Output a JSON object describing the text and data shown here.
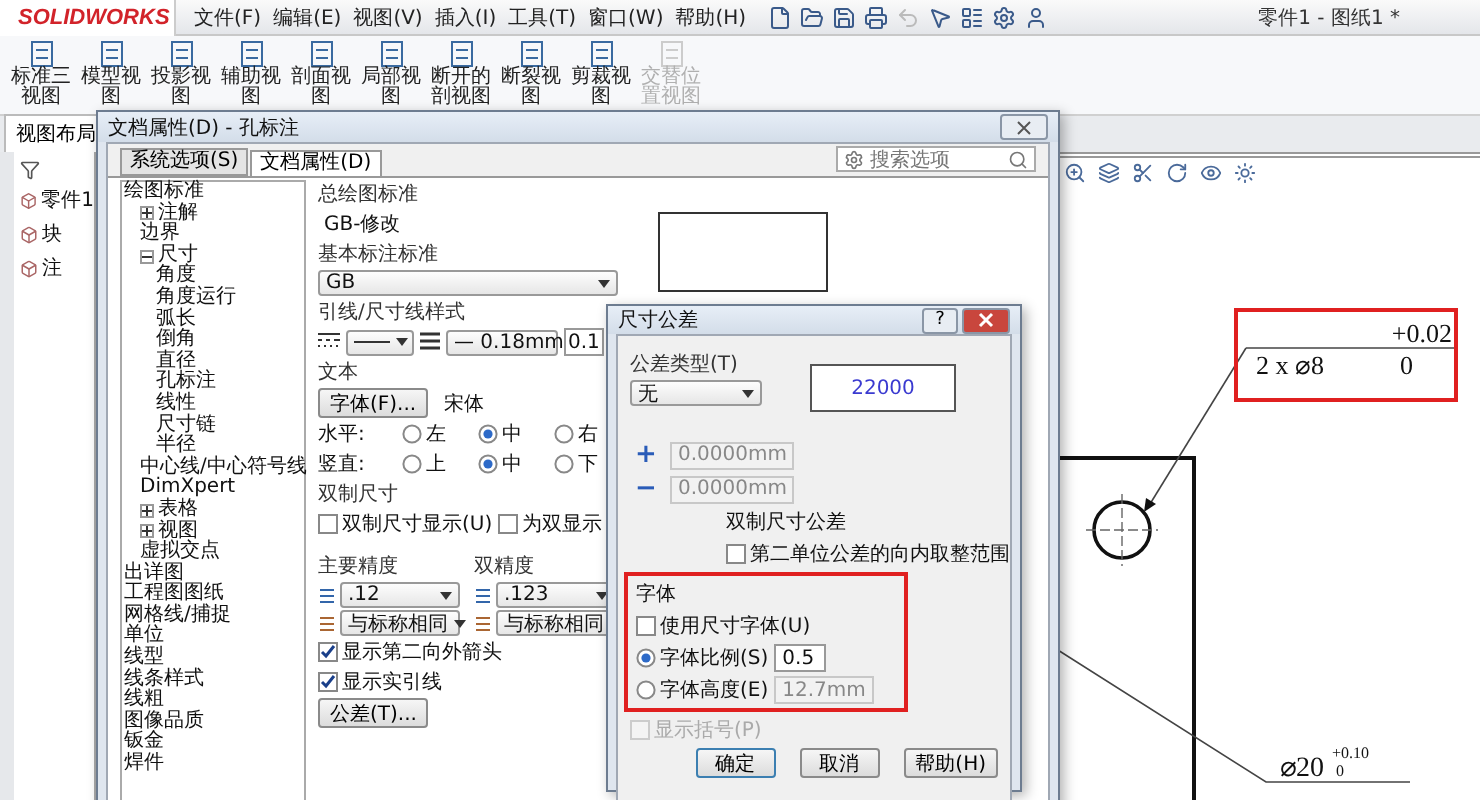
{
  "app_bar": {
    "logo": "SOLIDWORKS",
    "menus": [
      "文件(F)",
      "编辑(E)",
      "视图(V)",
      "插入(I)",
      "工具(T)",
      "窗口(W)",
      "帮助(H)"
    ],
    "document_title": "零件1 - 图纸1 *"
  },
  "commands": [
    {
      "label": "标准三视图",
      "disabled": false
    },
    {
      "label": "模型视图",
      "disabled": false
    },
    {
      "label": "投影视图",
      "disabled": false
    },
    {
      "label": "辅助视图",
      "disabled": false
    },
    {
      "label": "剖面视图",
      "disabled": false
    },
    {
      "label": "局部视图",
      "disabled": false
    },
    {
      "label": "断开的剖视图",
      "disabled": false
    },
    {
      "label": "断裂视图",
      "disabled": false
    },
    {
      "label": "剪裁视图",
      "disabled": false
    },
    {
      "label": "交替位置视图",
      "disabled": true
    }
  ],
  "tabs": [
    {
      "label": "视图布局",
      "selected": true
    }
  ],
  "feature_tree": {
    "items": [
      {
        "label": "零件1"
      },
      {
        "label": "块"
      },
      {
        "label": "注"
      }
    ]
  },
  "drawing": {
    "hole_callout": {
      "upper": "+0.02",
      "text": "2 x ⌀8",
      "lower": "0",
      "highlighted": true
    },
    "diameter_dimension": {
      "text": "⌀20",
      "upper": "+0.10",
      "lower": "0"
    }
  },
  "document_properties": {
    "title": "文档属性(D) - 孔标注",
    "tabs": [
      {
        "label": "系统选项(S)",
        "selected": false
      },
      {
        "label": "文档属性(D)",
        "selected": true
      }
    ],
    "search": {
      "placeholder": "搜索选项"
    },
    "tree": [
      {
        "label": "绘图标准",
        "children": [
          {
            "label": "注解",
            "expanded": false
          },
          {
            "label": "边界"
          },
          {
            "label": "尺寸",
            "expanded": true,
            "children": [
              {
                "label": "角度"
              },
              {
                "label": "角度运行"
              },
              {
                "label": "弧长"
              },
              {
                "label": "倒角"
              },
              {
                "label": "直径"
              },
              {
                "label": "孔标注"
              },
              {
                "label": "线性"
              },
              {
                "label": "尺寸链"
              },
              {
                "label": "半径"
              }
            ]
          },
          {
            "label": "中心线/中心符号线"
          },
          {
            "label": "DimXpert"
          },
          {
            "label": "表格",
            "expanded": false
          },
          {
            "label": "视图",
            "expanded": false
          },
          {
            "label": "虚拟交点"
          }
        ]
      },
      {
        "label": "出详图"
      },
      {
        "label": "工程图图纸"
      },
      {
        "label": "网格线/捕捉"
      },
      {
        "label": "单位"
      },
      {
        "label": "线型"
      },
      {
        "label": "线条样式"
      },
      {
        "label": "线粗"
      },
      {
        "label": "图像品质"
      },
      {
        "label": "钣金"
      },
      {
        "label": "焊件"
      }
    ],
    "overall_standard": {
      "label": "总绘图标准",
      "value": "GB-修改"
    },
    "base_standard": {
      "label": "基本标注标准",
      "value": "GB"
    },
    "leader_style": {
      "label": "引线/尺寸线样式",
      "thickness": "— 0.18mm",
      "custom": "0.1"
    },
    "text": {
      "label": "文本",
      "font_button": "字体(F)...",
      "font": "宋体",
      "alignments": [
        {
          "label": "水平:",
          "options": [
            {
              "label": "左",
              "selected": false
            },
            {
              "label": "中",
              "selected": true
            },
            {
              "label": "右",
              "selected": false
            }
          ]
        },
        {
          "label": "竖直:",
          "options": [
            {
              "label": "上",
              "selected": false
            },
            {
              "label": "中",
              "selected": true
            },
            {
              "label": "下",
              "selected": false
            }
          ]
        }
      ]
    },
    "dual": {
      "label": "双制尺寸",
      "options": [
        {
          "label": "双制尺寸显示(U)",
          "checked": false
        },
        {
          "label": "为双显示",
          "checked": false
        }
      ]
    },
    "precisions": [
      {
        "label": "主要精度",
        "value": ".12",
        "tolerance": "与标称相同"
      },
      {
        "label": "双精度",
        "value": ".123",
        "tolerance": "与标称相同"
      }
    ],
    "checks": [
      {
        "label": "显示第二向外箭头",
        "checked": true
      },
      {
        "label": "显示实引线",
        "checked": true
      }
    ],
    "tolerance_button": "公差(T)..."
  },
  "tolerance_dialog": {
    "title": "尺寸公差",
    "help": "?",
    "type_label": "公差类型(T)",
    "type": "无",
    "preview": "22000",
    "limits": [
      {
        "sign": "+",
        "value": "0.0000mm",
        "disabled": true
      },
      {
        "sign": "−",
        "value": "0.0000mm",
        "disabled": true
      }
    ],
    "dual_label": "双制尺寸公差",
    "dual_option": {
      "label": "第二单位公差的向内取整范围",
      "checked": false
    },
    "font_group": {
      "label": "字体",
      "highlighted": true,
      "use_dim_font": {
        "label": "使用尺寸字体(U)",
        "checked": false
      },
      "options": [
        {
          "label": "字体比例(S)",
          "value": "0.5",
          "selected": true
        },
        {
          "label": "字体高度(E)",
          "value": "12.7mm",
          "selected": false
        }
      ]
    },
    "parentheses": {
      "label": "显示括号(P)",
      "checked": false,
      "disabled": true
    },
    "buttons": [
      {
        "label": "确定",
        "default": true
      },
      {
        "label": "取消",
        "default": false
      },
      {
        "label": "帮助(H)",
        "default": false
      }
    ]
  }
}
